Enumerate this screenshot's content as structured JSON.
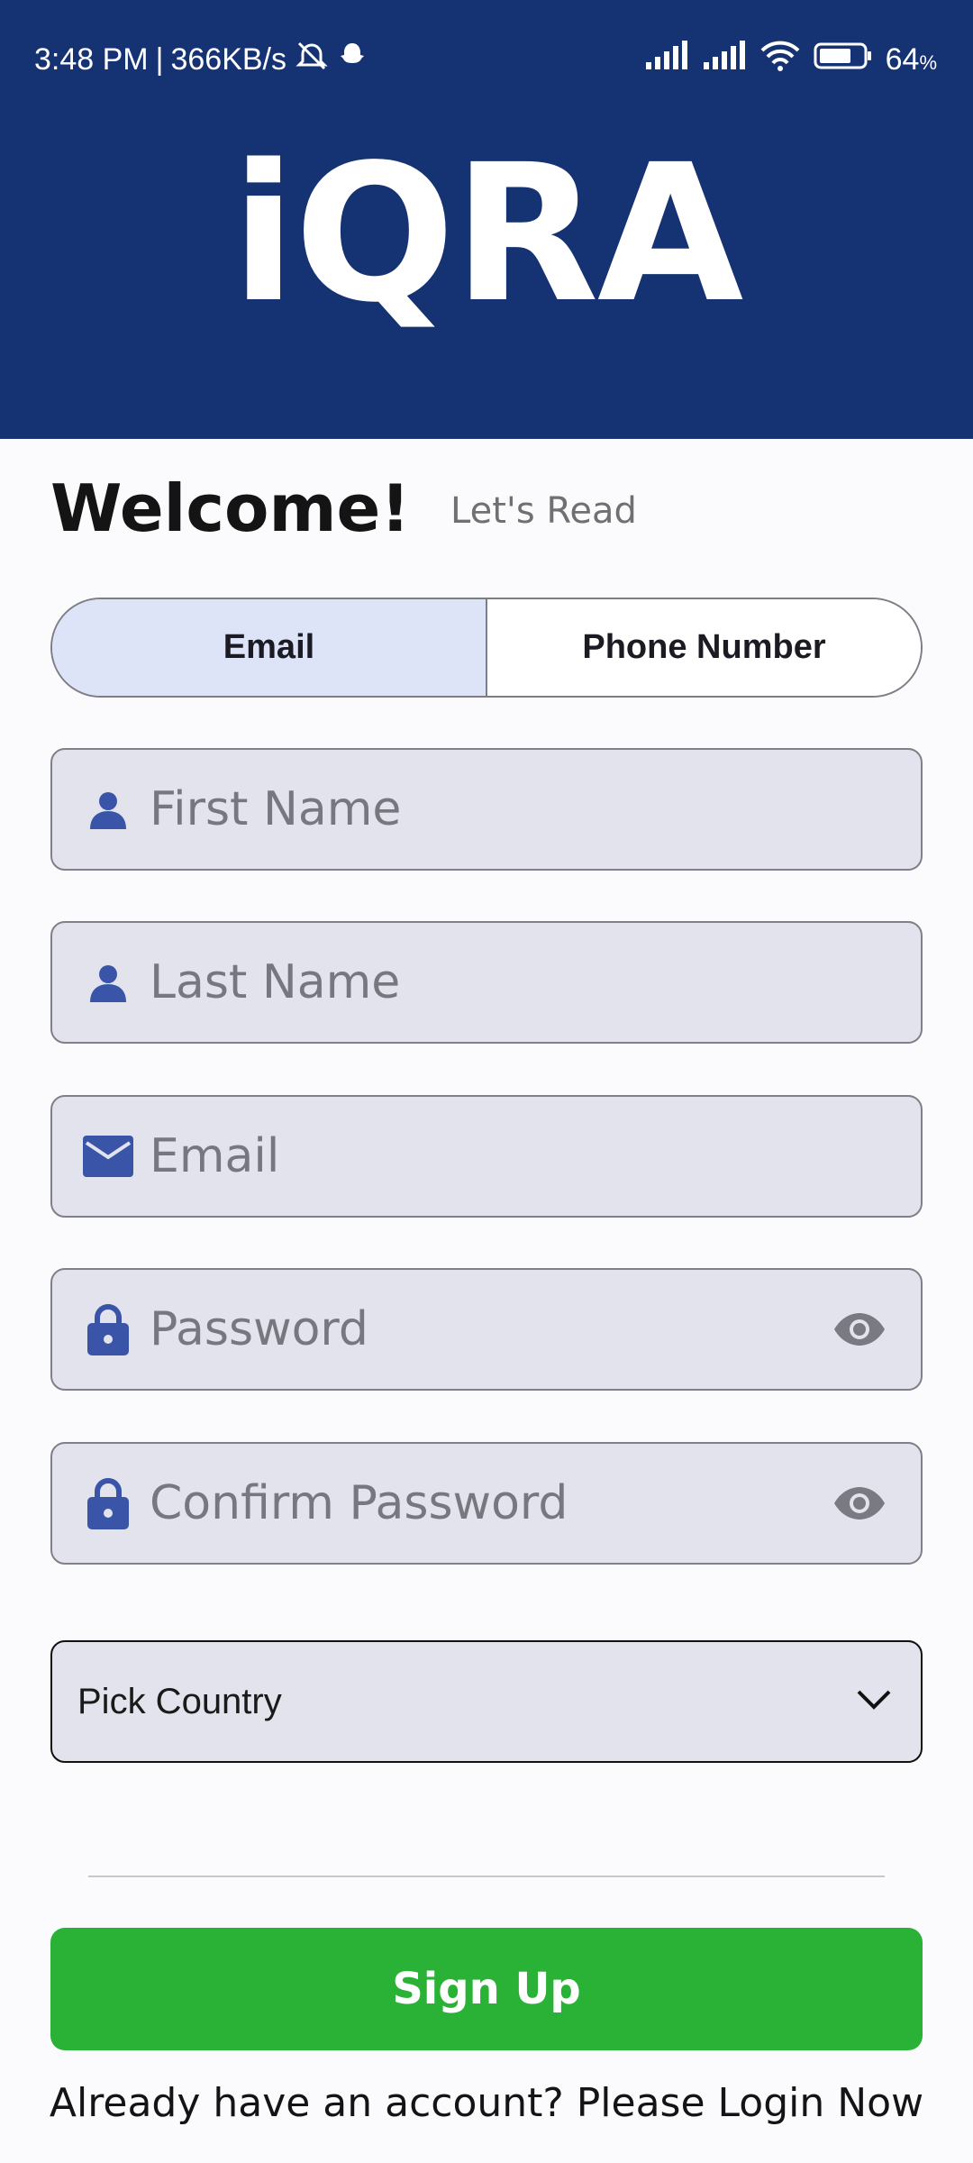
{
  "status_bar": {
    "time": "3:48 PM",
    "separator": "|",
    "net_speed": "366KB/s",
    "battery": "64",
    "battery_unit": "%"
  },
  "header": {
    "logo": "iQRA"
  },
  "welcome": {
    "title": "Welcome!",
    "subtitle": "Let's Read"
  },
  "tabs": [
    {
      "label": "Email",
      "active": true
    },
    {
      "label": "Phone Number",
      "active": false
    }
  ],
  "fields": {
    "first_name": {
      "placeholder": "First Name",
      "icon": "person-icon"
    },
    "last_name": {
      "placeholder": "Last Name",
      "icon": "person-icon"
    },
    "email": {
      "placeholder": "Email",
      "icon": "mail-icon"
    },
    "password": {
      "placeholder": "Password",
      "icon": "lock-icon"
    },
    "confirm_password": {
      "placeholder": "Confirm Password",
      "icon": "lock-icon"
    }
  },
  "country_select": {
    "label": "Pick Country"
  },
  "signup_button": {
    "label": "Sign Up"
  },
  "login_prompt": {
    "text": "Already have an account? Please Login Now"
  },
  "colors": {
    "header_bg": "#153373",
    "icon_blue": "#3a55a8",
    "signup_green": "#2ab236",
    "tab_active_bg": "#dde4f8",
    "field_bg": "#e2e3ec"
  }
}
